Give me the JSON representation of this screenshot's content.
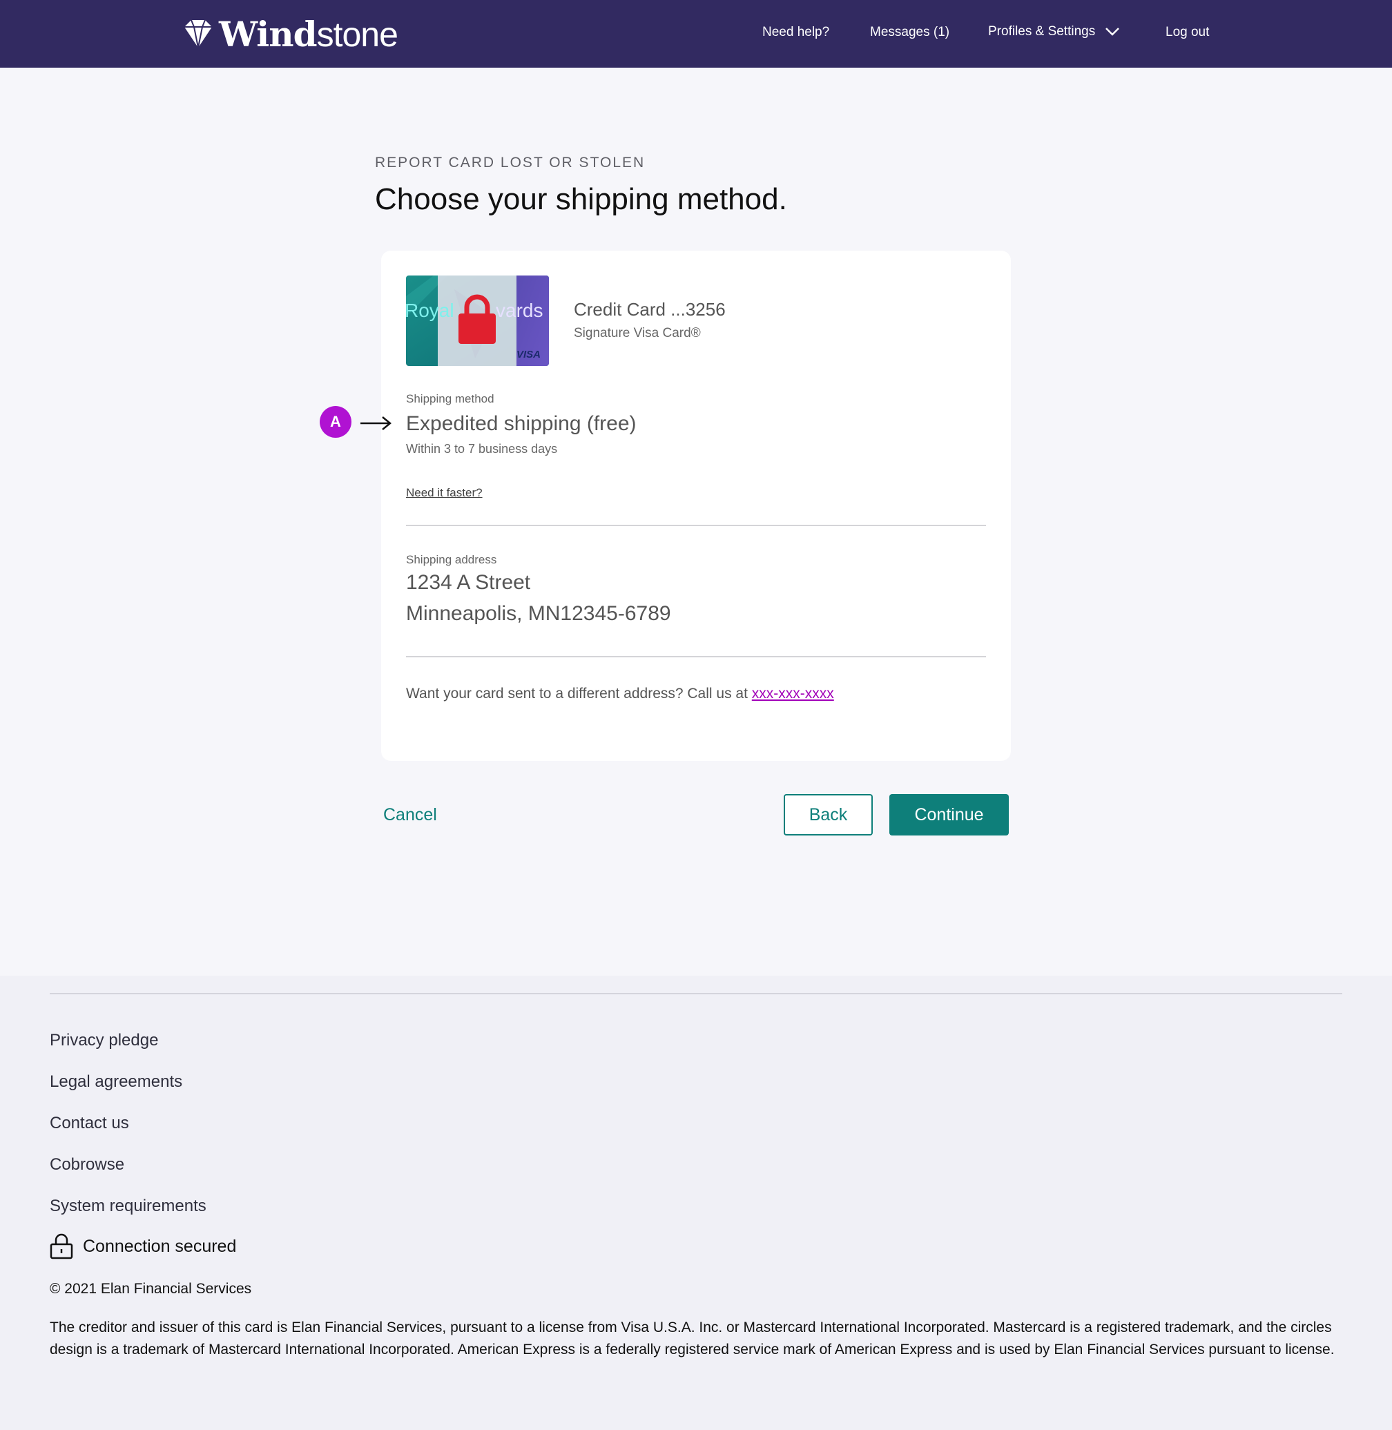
{
  "header": {
    "brand_bold": "Wind",
    "brand_light": "stone",
    "nav": {
      "help": "Need help?",
      "messages": "Messages (1)",
      "profiles": "Profiles & Settings",
      "logout": "Log out"
    }
  },
  "page": {
    "eyebrow": "REPORT CARD LOST OR STOLEN",
    "title": "Choose your shipping method."
  },
  "card": {
    "image_text_left": "Royal",
    "image_text_right": "vards",
    "image_network": "VISA",
    "name": "Credit Card ...3256",
    "type": "Signature Visa Card®"
  },
  "shipping_method": {
    "label": "Shipping method",
    "value": "Expedited shipping (free)",
    "note": "Within 3 to 7 business days",
    "faster_link": "Need it faster?"
  },
  "shipping_address": {
    "label": "Shipping address",
    "line1": "1234 A Street",
    "line2": "Minneapolis, MN12345-6789"
  },
  "different_address": {
    "text": "Want your card sent to a different address? Call us at ",
    "phone": "xxx-xxx-xxxx"
  },
  "annotation": {
    "marker": "A"
  },
  "actions": {
    "cancel": "Cancel",
    "back": "Back",
    "continue": "Continue"
  },
  "footer": {
    "links": [
      "Privacy pledge",
      "Legal agreements",
      "Contact us",
      "Cobrowse",
      "System requirements"
    ],
    "secured": "Connection secured",
    "copyright": "© 2021 Elan Financial Services",
    "legal": "The creditor and issuer of this card is Elan Financial Services, pursuant to a license from Visa U.S.A. Inc. or Mastercard International Incorporated. Mastercard is a registered trademark, and the circles design is a trademark of Mastercard International Incorporated. American Express is a federally registered service mark of American Express and is used by Elan Financial Services pursuant to license."
  },
  "colors": {
    "header_bg": "#322a61",
    "accent_teal": "#0e7f7a",
    "annotation_purple": "#b012d2",
    "link_purple": "#a100b8",
    "lock_red": "#e0202e"
  }
}
